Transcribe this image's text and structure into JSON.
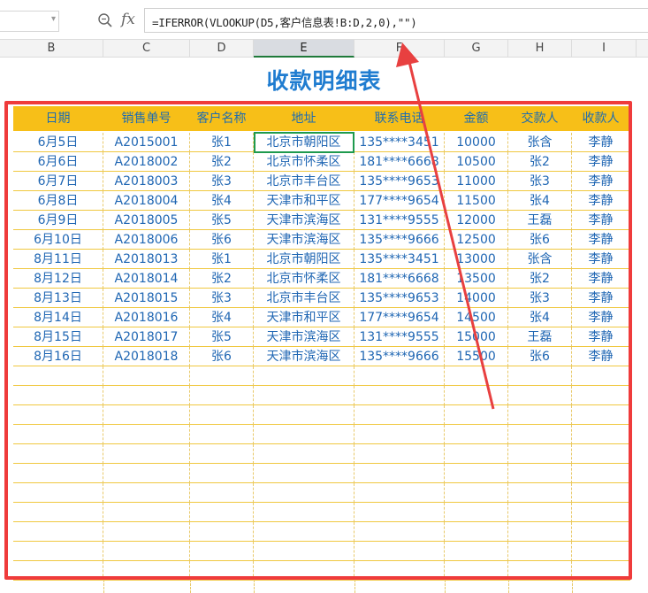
{
  "formula_bar": {
    "formula": "=IFERROR(VLOOKUP(D5,客户信息表!B:D,2,0),\"\")",
    "fx_label": "fx"
  },
  "column_headers": [
    "B",
    "C",
    "D",
    "E",
    "F",
    "G",
    "H",
    "I"
  ],
  "selected_column": "E",
  "sheet": {
    "title": "收款明细表",
    "headers": [
      "日期",
      "销售单号",
      "客户名称",
      "地址",
      "联系电话",
      "金额",
      "交款人",
      "收款人"
    ],
    "rows": [
      [
        "6月5日",
        "A2015001",
        "张1",
        "北京市朝阳区",
        "135****3451",
        "10000",
        "张含",
        "李静"
      ],
      [
        "6月6日",
        "A2018002",
        "张2",
        "北京市怀柔区",
        "181****6668",
        "10500",
        "张2",
        "李静"
      ],
      [
        "6月7日",
        "A2018003",
        "张3",
        "北京市丰台区",
        "135****9653",
        "11000",
        "张3",
        "李静"
      ],
      [
        "6月8日",
        "A2018004",
        "张4",
        "天津市和平区",
        "177****9654",
        "11500",
        "张4",
        "李静"
      ],
      [
        "6月9日",
        "A2018005",
        "张5",
        "天津市滨海区",
        "131****9555",
        "12000",
        "王磊",
        "李静"
      ],
      [
        "6月10日",
        "A2018006",
        "张6",
        "天津市滨海区",
        "135****9666",
        "12500",
        "张6",
        "李静"
      ],
      [
        "8月11日",
        "A2018013",
        "张1",
        "北京市朝阳区",
        "135****3451",
        "13000",
        "张含",
        "李静"
      ],
      [
        "8月12日",
        "A2018014",
        "张2",
        "北京市怀柔区",
        "181****6668",
        "13500",
        "张2",
        "李静"
      ],
      [
        "8月13日",
        "A2018015",
        "张3",
        "北京市丰台区",
        "135****9653",
        "14000",
        "张3",
        "李静"
      ],
      [
        "8月14日",
        "A2018016",
        "张4",
        "天津市和平区",
        "177****9654",
        "14500",
        "张4",
        "李静"
      ],
      [
        "8月15日",
        "A2018017",
        "张5",
        "天津市滨海区",
        "131****9555",
        "15000",
        "王磊",
        "李静"
      ],
      [
        "8月16日",
        "A2018018",
        "张6",
        "天津市滨海区",
        "135****9666",
        "15500",
        "张6",
        "李静"
      ]
    ],
    "empty_rows": 11
  },
  "colors": {
    "title": "#1f7cd0",
    "header_fill": "#f7bf18",
    "text": "#1f66b3",
    "highlight_border": "#ef3b3b",
    "annotation_arrow": "#e84040",
    "active_cell_border": "#1e9a4e"
  }
}
